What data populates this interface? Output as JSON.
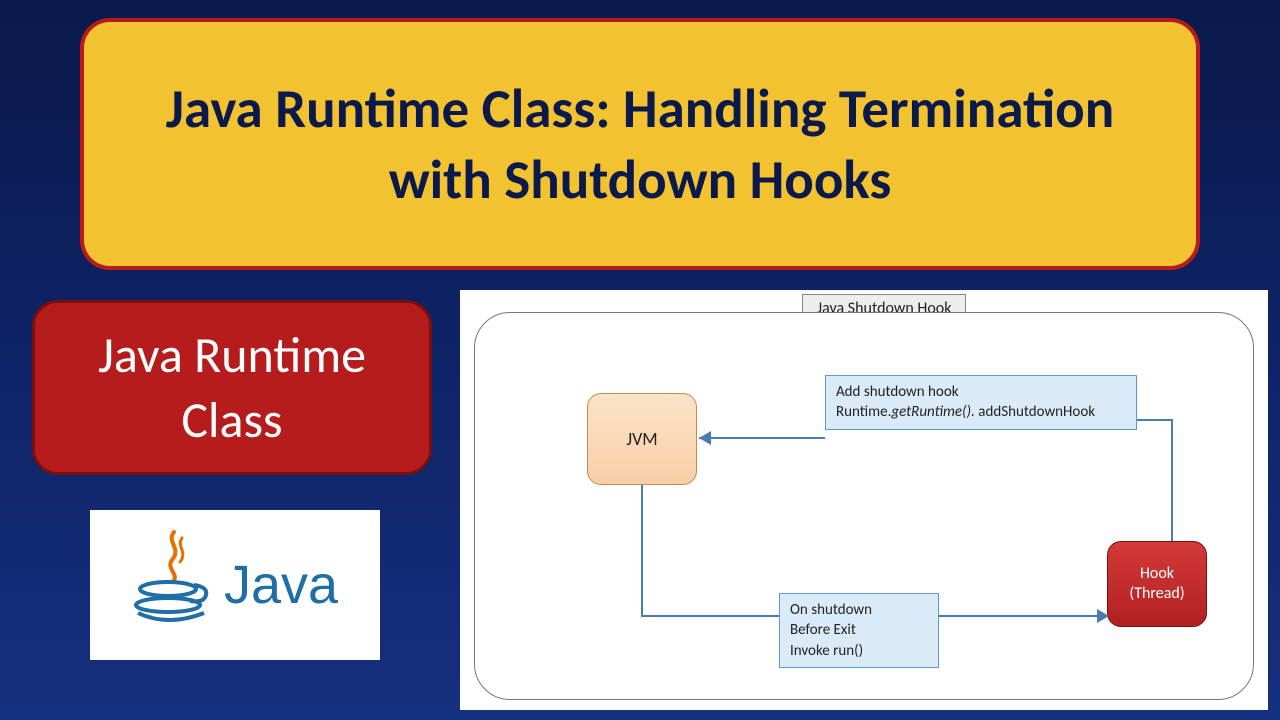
{
  "title": "Java Runtime Class: Handling Termination with Shutdown Hooks",
  "subtitle": "Java Runtime Class",
  "logo": {
    "word": "Java"
  },
  "diagram": {
    "title": "Java Shutdown Hook",
    "jvm": "JVM",
    "hook_line1": "Hook",
    "hook_line2": "(Thread)",
    "note_top_line1": "Add shutdown hook",
    "note_top_line2a": "Runtime.",
    "note_top_line2b": "getRuntime().",
    "note_top_line2c": " addShutdownHook",
    "note_bottom_line1": "On shutdown",
    "note_bottom_line2": "Before Exit",
    "note_bottom_line3": "Invoke run()"
  },
  "colors": {
    "title_bg": "#f2c230",
    "title_border": "#b71c1c",
    "sub_bg": "#b71c1c",
    "jvm_bg": "#f8cfa6",
    "hook_bg": "#b22020",
    "note_bg": "#dbeaf7",
    "connector": "#4a7bb5"
  }
}
